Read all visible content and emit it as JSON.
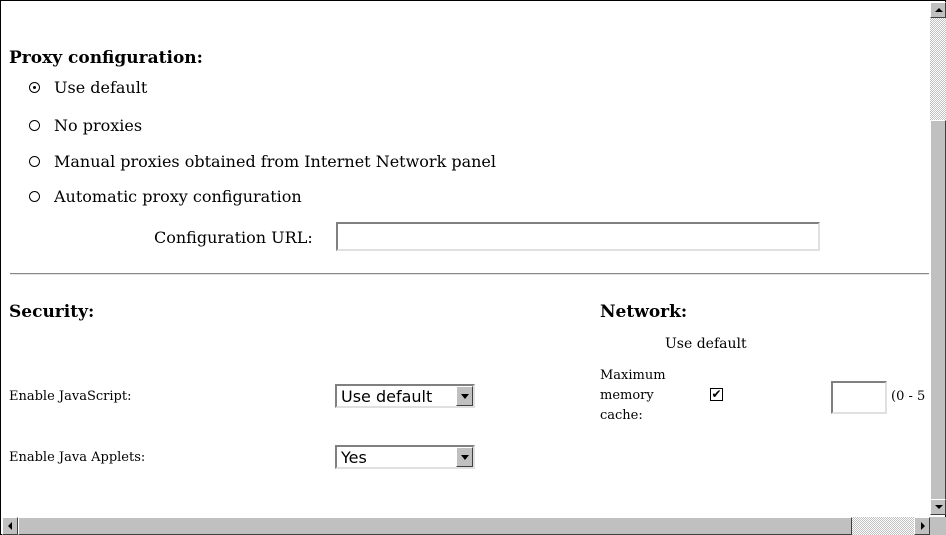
{
  "proxy": {
    "title": "Proxy configuration:",
    "options": [
      {
        "label": "Use default",
        "checked": true
      },
      {
        "label": "No proxies",
        "checked": false
      },
      {
        "label": "Manual proxies obtained from Internet Network panel",
        "checked": false
      },
      {
        "label": "Automatic proxy configuration",
        "checked": false
      }
    ],
    "config_url_label": "Configuration URL:",
    "config_url_value": ""
  },
  "security": {
    "title": "Security:",
    "javascript_label": "Enable JavaScript:",
    "javascript_value": "Use default",
    "applets_label": "Enable Java Applets:",
    "applets_value": "Yes"
  },
  "network": {
    "title": "Network:",
    "use_default_header": "Use default",
    "max_memory_label_1": "Maximum",
    "max_memory_label_2": "memory",
    "max_memory_label_3": "cache:",
    "max_memory_use_default": true,
    "max_memory_checkmark": "✔",
    "max_memory_value": "",
    "max_memory_range": "(0 - 5"
  }
}
